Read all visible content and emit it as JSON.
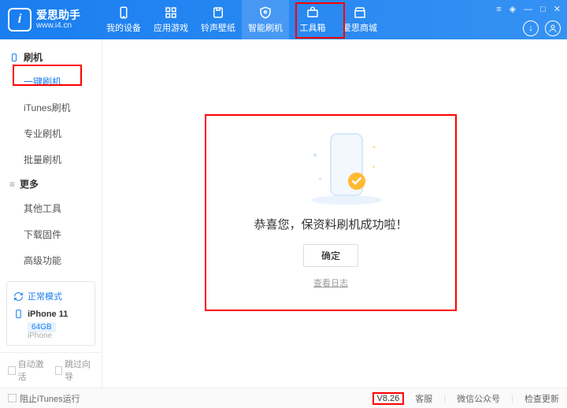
{
  "header": {
    "logo_letter": "i",
    "title": "爱思助手",
    "url": "www.i4.cn",
    "nav": [
      {
        "label": "我的设备"
      },
      {
        "label": "应用游戏"
      },
      {
        "label": "铃声壁纸"
      },
      {
        "label": "智能刷机"
      },
      {
        "label": "工具箱"
      },
      {
        "label": "爱思商城"
      }
    ]
  },
  "sidebar": {
    "section1": "刷机",
    "items1": [
      "一键刷机",
      "iTunes刷机",
      "专业刷机",
      "批量刷机"
    ],
    "section2": "更多",
    "items2": [
      "其他工具",
      "下载固件",
      "高级功能"
    ],
    "mode": "正常模式",
    "device": "iPhone 11",
    "storage": "64GB",
    "device_sub": "iPhone",
    "chk1": "自动激活",
    "chk2": "跳过向导"
  },
  "main": {
    "success_text": "恭喜您，保资料刷机成功啦！",
    "ok": "确定",
    "log": "查看日志"
  },
  "footer": {
    "block_itunes": "阻止iTunes运行",
    "version": "V8.26",
    "links": [
      "客服",
      "微信公众号",
      "检查更新"
    ]
  }
}
